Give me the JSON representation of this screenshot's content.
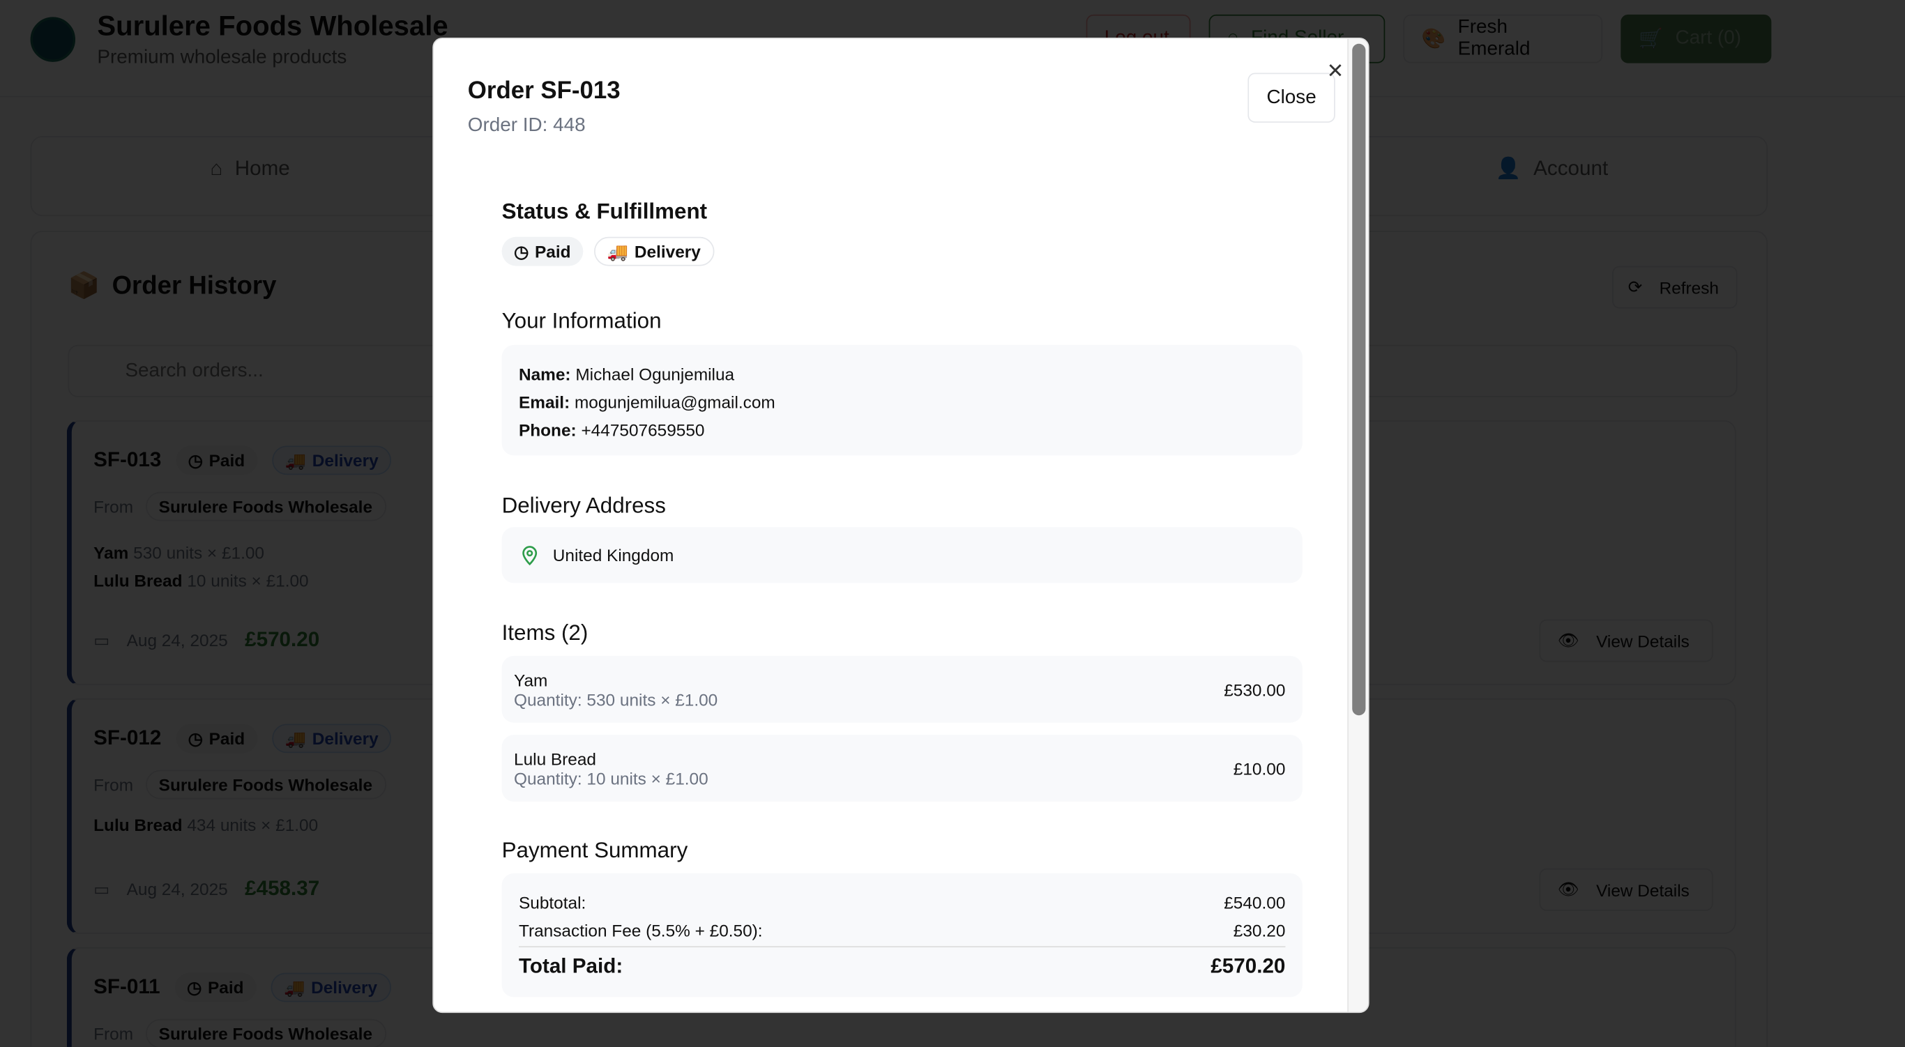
{
  "header": {
    "title": "Surulere Foods Wholesale",
    "subtitle": "Premium wholesale products",
    "logout": "Log out",
    "find_seller": "Find Seller",
    "theme": "Fresh Emerald",
    "cart": "Cart (0)"
  },
  "nav": {
    "home": "Home",
    "account": "Account"
  },
  "orders_page": {
    "title": "Order History",
    "refresh": "Refresh",
    "search_placeholder": "Search orders...",
    "from_label": "From",
    "view_details": "View Details",
    "orders": [
      {
        "id": "SF-013",
        "status": "Paid",
        "fulfillment": "Delivery",
        "seller": "Surulere Foods Wholesale",
        "items": [
          {
            "name": "Yam",
            "detail": "530 units × £1.00"
          },
          {
            "name": "Lulu Bread",
            "detail": "10 units × £1.00"
          }
        ],
        "date": "Aug 24, 2025",
        "total": "£570.20"
      },
      {
        "id": "SF-012",
        "status": "Paid",
        "fulfillment": "Delivery",
        "seller": "Surulere Foods Wholesale",
        "items": [
          {
            "name": "Lulu Bread",
            "detail": "434 units × £1.00"
          }
        ],
        "date": "Aug 24, 2025",
        "total": "£458.37"
      },
      {
        "id": "SF-011",
        "status": "Paid",
        "fulfillment": "Delivery",
        "seller": "Surulere Foods Wholesale"
      }
    ]
  },
  "modal": {
    "title": "Order SF-013",
    "order_id": "Order ID: 448",
    "close": "Close",
    "status_heading": "Status & Fulfillment",
    "status": "Paid",
    "fulfillment": "Delivery",
    "fulfillment_emoji": "🚚",
    "info_heading": "Your Information",
    "name_label": "Name:",
    "name": "Michael Ogunjemilua",
    "email_label": "Email:",
    "email": "mogunjemilua@gmail.com",
    "phone_label": "Phone:",
    "phone": "+447507659550",
    "address_heading": "Delivery Address",
    "address": "United Kingdom",
    "items_heading": "Items (2)",
    "items": [
      {
        "name": "Yam",
        "qty": "Quantity: 530 units × £1.00",
        "price": "£530.00"
      },
      {
        "name": "Lulu Bread",
        "qty": "Quantity: 10 units × £1.00",
        "price": "£10.00"
      }
    ],
    "payment_heading": "Payment Summary",
    "subtotal_label": "Subtotal:",
    "subtotal": "£540.00",
    "fee_label": "Transaction Fee (5.5% + £0.50):",
    "fee": "£30.20",
    "total_label": "Total Paid:",
    "total": "£570.20"
  },
  "colors": {
    "accent_green": "#2e7d32",
    "order_border": "#1e3a8a",
    "delivery_blue": "#1e40af",
    "logout_red": "#b91c1c"
  }
}
